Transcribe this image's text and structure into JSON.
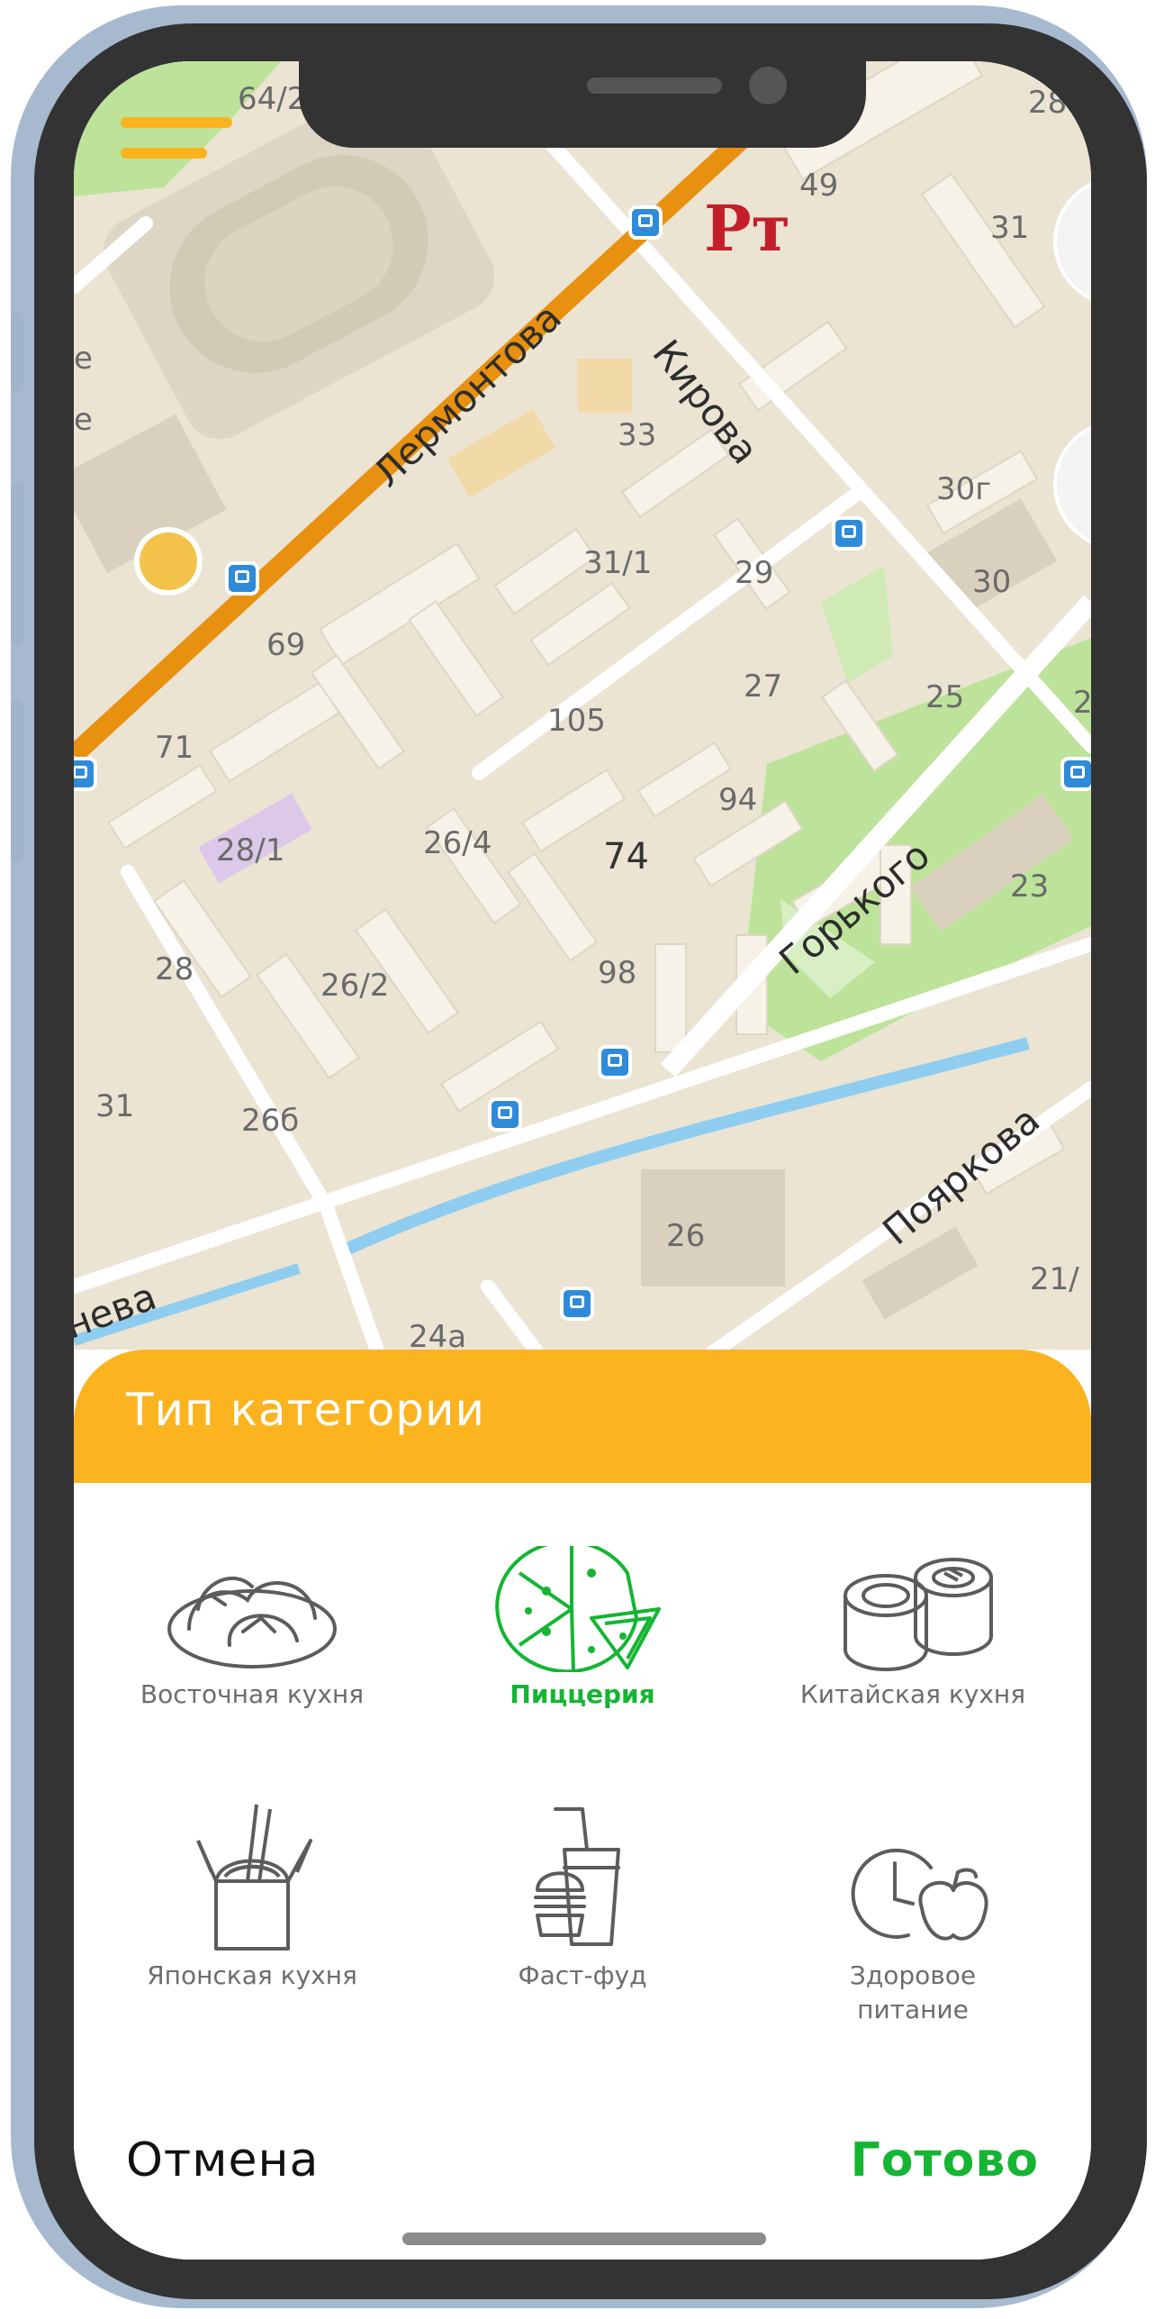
{
  "map": {
    "streets": [
      "Лермонтова",
      "Кирова",
      "Горького",
      "Пояркова",
      "нева"
    ],
    "house_numbers": [
      "64/2",
      "49",
      "31",
      "33",
      "31/1",
      "29",
      "30г",
      "30",
      "69",
      "27",
      "25",
      "105",
      "71",
      "94",
      "23",
      "28/1",
      "26/4",
      "74",
      "28",
      "26/2",
      "98",
      "31",
      "26б",
      "26",
      "21/",
      "24а",
      "28",
      "е",
      "е",
      "2"
    ]
  },
  "sheet": {
    "title": "Тип категории",
    "categories": [
      {
        "label": "Восточная кухня",
        "icon": "dumplings-icon",
        "selected": false
      },
      {
        "label": "Пиццерия",
        "icon": "pizza-icon",
        "selected": true
      },
      {
        "label": "Китайская кухня",
        "icon": "sushi-rolls-icon",
        "selected": false
      },
      {
        "label": "Японская кухня",
        "icon": "noodle-box-icon",
        "selected": false
      },
      {
        "label": "Фаст-фуд",
        "icon": "burger-drink-icon",
        "selected": false
      },
      {
        "label": "Здоровое питание",
        "icon": "clock-apple-icon",
        "selected": false
      }
    ],
    "cancel_label": "Отмена",
    "done_label": "Готово"
  },
  "colors": {
    "accent": "#fbb31f",
    "selected": "#14b533",
    "road_main": "#e8900f",
    "water": "#8fcdf0",
    "park": "#bde39a",
    "frame": "#a6b9cf"
  }
}
